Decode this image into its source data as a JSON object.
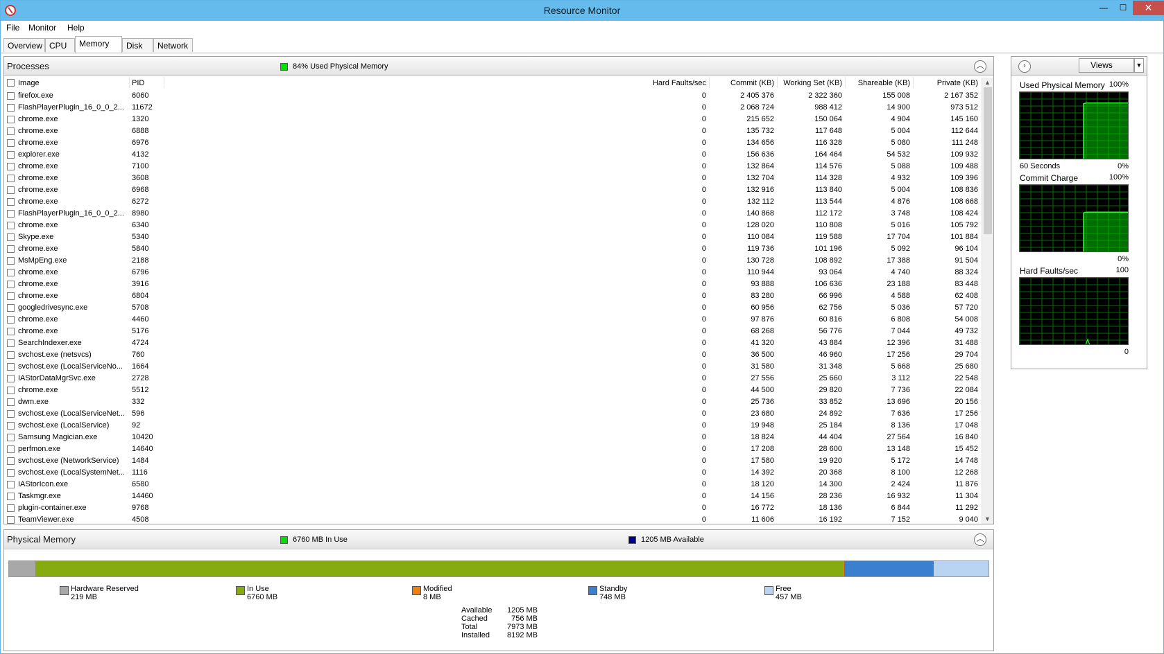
{
  "window": {
    "title": "Resource Monitor"
  },
  "menu": {
    "file": "File",
    "monitor": "Monitor",
    "help": "Help"
  },
  "tabs": {
    "overview": "Overview",
    "cpu": "CPU",
    "memory": "Memory",
    "disk": "Disk",
    "network": "Network"
  },
  "processes": {
    "title": "Processes",
    "usage_label": "84% Used Physical Memory",
    "usage_color": "#00e000",
    "columns": {
      "image": "Image",
      "pid": "PID",
      "hard_faults": "Hard Faults/sec",
      "commit": "Commit (KB)",
      "working_set": "Working Set (KB)",
      "shareable": "Shareable (KB)",
      "private": "Private (KB)"
    },
    "rows": [
      {
        "image": "firefox.exe",
        "pid": "6060",
        "hard": "0",
        "commit": "2 405 376",
        "ws": "2 322 360",
        "share": "155 008",
        "priv": "2 167 352"
      },
      {
        "image": "FlashPlayerPlugin_16_0_0_2...",
        "pid": "11672",
        "hard": "0",
        "commit": "2 068 724",
        "ws": "988 412",
        "share": "14 900",
        "priv": "973 512"
      },
      {
        "image": "chrome.exe",
        "pid": "1320",
        "hard": "0",
        "commit": "215 652",
        "ws": "150 064",
        "share": "4 904",
        "priv": "145 160"
      },
      {
        "image": "chrome.exe",
        "pid": "6888",
        "hard": "0",
        "commit": "135 732",
        "ws": "117 648",
        "share": "5 004",
        "priv": "112 644"
      },
      {
        "image": "chrome.exe",
        "pid": "6976",
        "hard": "0",
        "commit": "134 656",
        "ws": "116 328",
        "share": "5 080",
        "priv": "111 248"
      },
      {
        "image": "explorer.exe",
        "pid": "4132",
        "hard": "0",
        "commit": "156 636",
        "ws": "164 464",
        "share": "54 532",
        "priv": "109 932"
      },
      {
        "image": "chrome.exe",
        "pid": "7100",
        "hard": "0",
        "commit": "132 864",
        "ws": "114 576",
        "share": "5 088",
        "priv": "109 488"
      },
      {
        "image": "chrome.exe",
        "pid": "3608",
        "hard": "0",
        "commit": "132 704",
        "ws": "114 328",
        "share": "4 932",
        "priv": "109 396"
      },
      {
        "image": "chrome.exe",
        "pid": "6968",
        "hard": "0",
        "commit": "132 916",
        "ws": "113 840",
        "share": "5 004",
        "priv": "108 836"
      },
      {
        "image": "chrome.exe",
        "pid": "6272",
        "hard": "0",
        "commit": "132 112",
        "ws": "113 544",
        "share": "4 876",
        "priv": "108 668"
      },
      {
        "image": "FlashPlayerPlugin_16_0_0_2...",
        "pid": "8980",
        "hard": "0",
        "commit": "140 868",
        "ws": "112 172",
        "share": "3 748",
        "priv": "108 424"
      },
      {
        "image": "chrome.exe",
        "pid": "6340",
        "hard": "0",
        "commit": "128 020",
        "ws": "110 808",
        "share": "5 016",
        "priv": "105 792"
      },
      {
        "image": "Skype.exe",
        "pid": "5340",
        "hard": "0",
        "commit": "110 084",
        "ws": "119 588",
        "share": "17 704",
        "priv": "101 884"
      },
      {
        "image": "chrome.exe",
        "pid": "5840",
        "hard": "0",
        "commit": "119 736",
        "ws": "101 196",
        "share": "5 092",
        "priv": "96 104"
      },
      {
        "image": "MsMpEng.exe",
        "pid": "2188",
        "hard": "0",
        "commit": "130 728",
        "ws": "108 892",
        "share": "17 388",
        "priv": "91 504"
      },
      {
        "image": "chrome.exe",
        "pid": "6796",
        "hard": "0",
        "commit": "110 944",
        "ws": "93 064",
        "share": "4 740",
        "priv": "88 324"
      },
      {
        "image": "chrome.exe",
        "pid": "3916",
        "hard": "0",
        "commit": "93 888",
        "ws": "106 636",
        "share": "23 188",
        "priv": "83 448"
      },
      {
        "image": "chrome.exe",
        "pid": "6804",
        "hard": "0",
        "commit": "83 280",
        "ws": "66 996",
        "share": "4 588",
        "priv": "62 408"
      },
      {
        "image": "googledrivesync.exe",
        "pid": "5708",
        "hard": "0",
        "commit": "60 956",
        "ws": "62 756",
        "share": "5 036",
        "priv": "57 720"
      },
      {
        "image": "chrome.exe",
        "pid": "4460",
        "hard": "0",
        "commit": "97 876",
        "ws": "60 816",
        "share": "6 808",
        "priv": "54 008"
      },
      {
        "image": "chrome.exe",
        "pid": "5176",
        "hard": "0",
        "commit": "68 268",
        "ws": "56 776",
        "share": "7 044",
        "priv": "49 732"
      },
      {
        "image": "SearchIndexer.exe",
        "pid": "4724",
        "hard": "0",
        "commit": "41 320",
        "ws": "43 884",
        "share": "12 396",
        "priv": "31 488"
      },
      {
        "image": "svchost.exe (netsvcs)",
        "pid": "760",
        "hard": "0",
        "commit": "36 500",
        "ws": "46 960",
        "share": "17 256",
        "priv": "29 704"
      },
      {
        "image": "svchost.exe (LocalServiceNo...",
        "pid": "1664",
        "hard": "0",
        "commit": "31 580",
        "ws": "31 348",
        "share": "5 668",
        "priv": "25 680"
      },
      {
        "image": "IAStorDataMgrSvc.exe",
        "pid": "2728",
        "hard": "0",
        "commit": "27 556",
        "ws": "25 660",
        "share": "3 112",
        "priv": "22 548"
      },
      {
        "image": "chrome.exe",
        "pid": "5512",
        "hard": "0",
        "commit": "44 500",
        "ws": "29 820",
        "share": "7 736",
        "priv": "22 084"
      },
      {
        "image": "dwm.exe",
        "pid": "332",
        "hard": "0",
        "commit": "25 736",
        "ws": "33 852",
        "share": "13 696",
        "priv": "20 156"
      },
      {
        "image": "svchost.exe (LocalServiceNet...",
        "pid": "596",
        "hard": "0",
        "commit": "23 680",
        "ws": "24 892",
        "share": "7 636",
        "priv": "17 256"
      },
      {
        "image": "svchost.exe (LocalService)",
        "pid": "92",
        "hard": "0",
        "commit": "19 948",
        "ws": "25 184",
        "share": "8 136",
        "priv": "17 048"
      },
      {
        "image": "Samsung Magician.exe",
        "pid": "10420",
        "hard": "0",
        "commit": "18 824",
        "ws": "44 404",
        "share": "27 564",
        "priv": "16 840"
      },
      {
        "image": "perfmon.exe",
        "pid": "14640",
        "hard": "0",
        "commit": "17 208",
        "ws": "28 600",
        "share": "13 148",
        "priv": "15 452"
      },
      {
        "image": "svchost.exe (NetworkService)",
        "pid": "1484",
        "hard": "0",
        "commit": "17 580",
        "ws": "19 920",
        "share": "5 172",
        "priv": "14 748"
      },
      {
        "image": "svchost.exe (LocalSystemNet...",
        "pid": "1116",
        "hard": "0",
        "commit": "14 392",
        "ws": "20 368",
        "share": "8 100",
        "priv": "12 268"
      },
      {
        "image": "IAStorIcon.exe",
        "pid": "6580",
        "hard": "0",
        "commit": "18 120",
        "ws": "14 300",
        "share": "2 424",
        "priv": "11 876"
      },
      {
        "image": "Taskmgr.exe",
        "pid": "14460",
        "hard": "0",
        "commit": "14 156",
        "ws": "28 236",
        "share": "16 932",
        "priv": "11 304"
      },
      {
        "image": "plugin-container.exe",
        "pid": "9768",
        "hard": "0",
        "commit": "16 772",
        "ws": "18 136",
        "share": "6 844",
        "priv": "11 292"
      },
      {
        "image": "TeamViewer.exe",
        "pid": "4508",
        "hard": "0",
        "commit": "11 606",
        "ws": "16 192",
        "share": "7 152",
        "priv": "9 040"
      }
    ]
  },
  "physical_memory": {
    "title": "Physical Memory",
    "in_use_label": "6760 MB In Use",
    "available_label": "1205 MB Available",
    "in_use_color": "#00e000",
    "available_color": "#00008b",
    "bar_fractions_percent": {
      "hardware_reserved": 2.7,
      "in_use": 82.5,
      "modified": 0.1,
      "standby": 9.1,
      "free": 5.6
    },
    "legend": [
      {
        "name": "Hardware Reserved",
        "value": "219 MB",
        "color": "#a8a8a8"
      },
      {
        "name": "In Use",
        "value": "6760 MB",
        "color": "#85ab10"
      },
      {
        "name": "Modified",
        "value": "8 MB",
        "color": "#f08010"
      },
      {
        "name": "Standby",
        "value": "748 MB",
        "color": "#3a7fd0"
      },
      {
        "name": "Free",
        "value": "457 MB",
        "color": "#b9d4f2"
      }
    ],
    "summary": [
      {
        "label": "Available",
        "value": "1205 MB"
      },
      {
        "label": "Cached",
        "value": "756 MB"
      },
      {
        "label": "Total",
        "value": "7973 MB"
      },
      {
        "label": "Installed",
        "value": "8192 MB"
      }
    ]
  },
  "graphs": {
    "views_label": "Views",
    "used_physical": {
      "title": "Used Physical Memory",
      "max": "100%",
      "min": "0%",
      "time": "60 Seconds",
      "current_percent": 84
    },
    "commit_charge": {
      "title": "Commit Charge",
      "max": "100%",
      "min": "0%",
      "current_percent": 60
    },
    "hard_faults": {
      "title": "Hard Faults/sec",
      "max": "100",
      "min": "0"
    }
  }
}
